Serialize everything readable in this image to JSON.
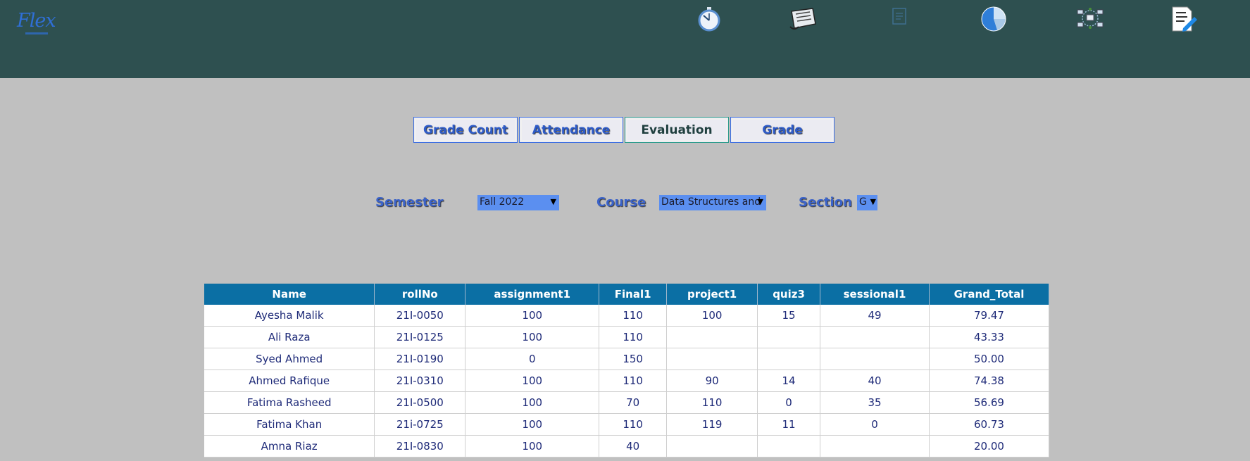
{
  "app": {
    "logo_text": "Flex"
  },
  "nav_icons": [
    "stopwatch-icon",
    "newspaper-icon",
    "document-icon",
    "pie-chart-icon",
    "network-icon",
    "edit-document-icon"
  ],
  "tabs": [
    {
      "label": "Grade Count",
      "active": false
    },
    {
      "label": "Attendance",
      "active": false
    },
    {
      "label": "Evaluation",
      "active": true
    },
    {
      "label": "Grade",
      "active": false
    }
  ],
  "filters": {
    "semester": {
      "label": "Semester",
      "value": "Fall 2022"
    },
    "course": {
      "label": "Course",
      "value": "Data Structures and"
    },
    "section": {
      "label": "Section",
      "value": "G"
    }
  },
  "table": {
    "columns": [
      "Name",
      "rollNo",
      "assignment1",
      "Final1",
      "project1",
      "quiz3",
      "sessional1",
      "Grand_Total"
    ],
    "rows": [
      [
        "Ayesha Malik",
        "21I-0050",
        "100",
        "110",
        "100",
        "15",
        "49",
        "79.47"
      ],
      [
        "Ali Raza",
        "21I-0125",
        "100",
        "110",
        "",
        "",
        "",
        "43.33"
      ],
      [
        "Syed Ahmed",
        "21I-0190",
        "0",
        "150",
        "",
        "",
        "",
        "50.00"
      ],
      [
        "Ahmed Rafique",
        "21I-0310",
        "100",
        "110",
        "90",
        "14",
        "40",
        "74.38"
      ],
      [
        "Fatima Rasheed",
        "21I-0500",
        "100",
        "70",
        "110",
        "0",
        "35",
        "56.69"
      ],
      [
        "Fatima Khan",
        "21i-0725",
        "100",
        "110",
        "119",
        "11",
        "0",
        "60.73"
      ],
      [
        "Amna Riaz",
        "21I-0830",
        "100",
        "40",
        "",
        "",
        "",
        "20.00"
      ]
    ]
  },
  "colors": {
    "header_bar": "#2e5050",
    "background": "#c0c0c0",
    "table_header": "#0b6fa4"
  }
}
